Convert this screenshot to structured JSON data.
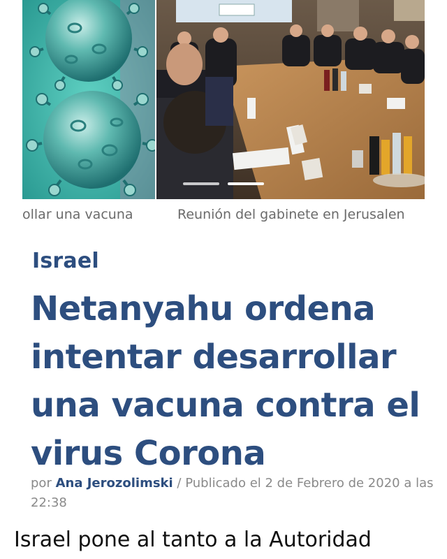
{
  "carousel": {
    "slides": [
      {
        "image": "coronavirus-illustration",
        "caption": "ollar una vacuna"
      },
      {
        "image": "cabinet-meeting-photo",
        "caption": "Reunión del gabinete en Jerusalen"
      }
    ],
    "active_index": 1
  },
  "article": {
    "category": "Israel",
    "headline": "Netanyahu ordena intentar desarrollar una vacuna contra el virus Corona",
    "byline_prefix": "por",
    "author": "Ana Jerozolimski",
    "separator": "/",
    "published": "Publicado el 2 de Febrero de 2020 a las 22:38",
    "lead": "Israel pone al tanto a la Autoridad"
  },
  "colors": {
    "brand": "#2d4e7f",
    "caption": "#6b6b6b",
    "meta": "#8a8a8a",
    "body": "#111111"
  }
}
